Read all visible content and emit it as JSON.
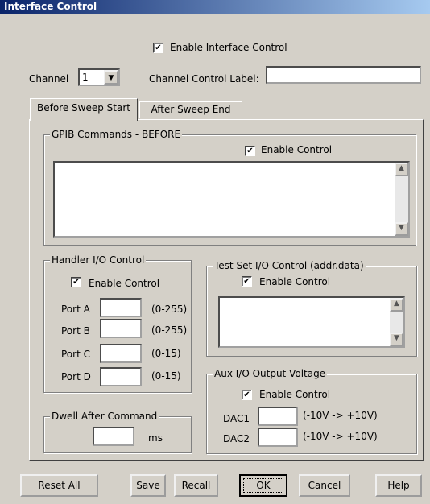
{
  "window": {
    "title": "Interface Control"
  },
  "enable_interface": {
    "label": "Enable Interface Control",
    "checked": true
  },
  "channel": {
    "label": "Channel",
    "value": "1",
    "control_label_caption": "Channel Control Label:",
    "control_label_value": ""
  },
  "tabs": [
    {
      "label": "Before Sweep Start"
    },
    {
      "label": "After Sweep End"
    }
  ],
  "gpib": {
    "title": "GPIB Commands - BEFORE",
    "enable_label": "Enable Control",
    "text": ""
  },
  "handler": {
    "title": "Handler I/O Control",
    "enable_label": "Enable Control",
    "ports": [
      {
        "label": "Port A",
        "range": "(0-255)",
        "value": ""
      },
      {
        "label": "Port B",
        "range": "(0-255)",
        "value": ""
      },
      {
        "label": "Port C",
        "range": "(0-15)",
        "value": ""
      },
      {
        "label": "Port D",
        "range": "(0-15)",
        "value": ""
      }
    ]
  },
  "testset": {
    "title": "Test Set I/O Control (addr.data)",
    "enable_label": "Enable Control",
    "text": ""
  },
  "aux": {
    "title": "Aux I/O Output Voltage",
    "enable_label": "Enable Control",
    "dacs": [
      {
        "label": "DAC1",
        "range": "(-10V -> +10V)",
        "value": ""
      },
      {
        "label": "DAC2",
        "range": "(-10V -> +10V)",
        "value": ""
      }
    ]
  },
  "dwell": {
    "title": "Dwell After Command",
    "unit": "ms",
    "value": ""
  },
  "buttons": {
    "reset": "Reset All",
    "save": "Save",
    "recall": "Recall",
    "ok": "OK",
    "cancel": "Cancel",
    "help": "Help"
  },
  "icons": {
    "check": "✔",
    "down": "▼",
    "up": "▲"
  }
}
